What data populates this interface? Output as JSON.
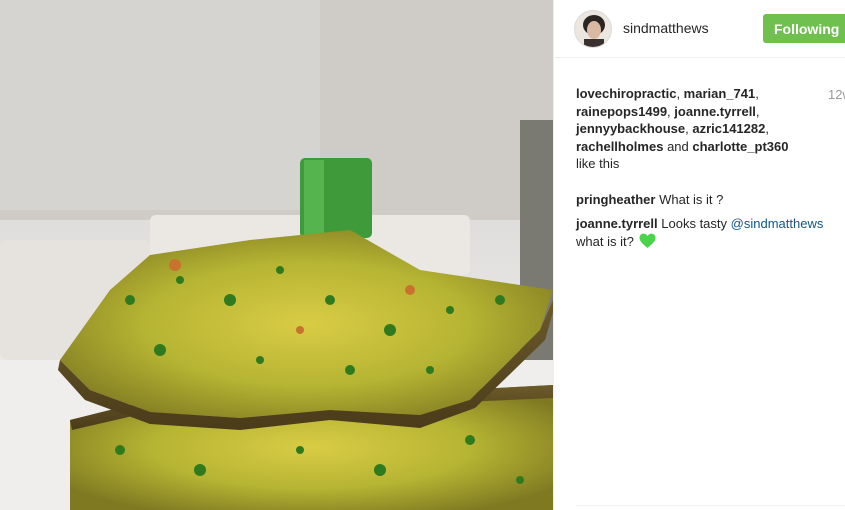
{
  "post": {
    "author": "sindmatthews",
    "follow_label": "Following",
    "time": "12w",
    "likes": {
      "users": [
        "lovechiropractic",
        "marian_741",
        "rainepops1499",
        "joanne.tyrrell",
        "jennyybackhouse",
        "azric141282",
        "rachellholmes"
      ],
      "and_text": "and",
      "last_user": "charlotte_pt360",
      "suffix": "like this"
    },
    "comments": [
      {
        "user": "pringheather",
        "text": "What is it ?"
      },
      {
        "user": "joanne.tyrrell",
        "prefix": "Looks tasty",
        "mention": "@sindmatthews",
        "text": "what is it?",
        "emoji": "green-heart-icon"
      }
    ]
  },
  "colors": {
    "follow_button": "#70c050",
    "mention": "#125688",
    "heart": "#4bd34b"
  }
}
